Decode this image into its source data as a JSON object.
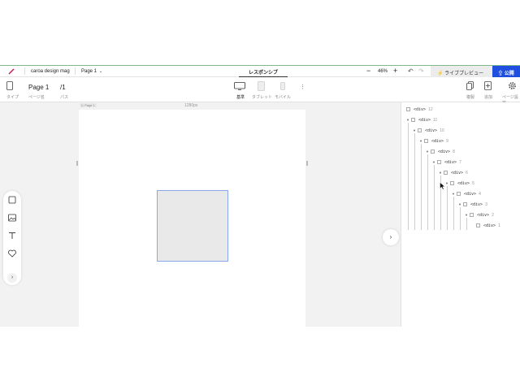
{
  "topbar": {
    "project_name": "caroa design mag",
    "page_selector": "Page 1",
    "mode_title": "レスポンシブ",
    "zoom_minus": "−",
    "zoom_level": "46%",
    "zoom_plus": "+",
    "live_preview": "ライブプレビュー",
    "publish": "公開"
  },
  "toolbar": {
    "type_label": "タイプ",
    "page_name": "Page 1",
    "page_name_label": "ページ名",
    "path": "/1",
    "path_label": "パス",
    "device_desktop": "基準",
    "device_tablet": "タブレット",
    "device_mobile": "モバイル",
    "duplicate_label": "複製",
    "add_label": "追加",
    "page_settings_label": "ページ設定"
  },
  "canvas": {
    "page_tag": "Page 1",
    "width_label": "1280px"
  },
  "layers": [
    {
      "tag": "<div>",
      "num": "12"
    },
    {
      "tag": "<div>",
      "num": "11"
    },
    {
      "tag": "<div>",
      "num": "10"
    },
    {
      "tag": "<div>",
      "num": "9"
    },
    {
      "tag": "<div>",
      "num": "8"
    },
    {
      "tag": "<div>",
      "num": "7"
    },
    {
      "tag": "<div>",
      "num": "6"
    },
    {
      "tag": "<div>",
      "num": "5"
    },
    {
      "tag": "<div>",
      "num": "4"
    },
    {
      "tag": "<div>",
      "num": "3"
    },
    {
      "tag": "<div>",
      "num": "2"
    },
    {
      "tag": "<div>",
      "num": "1"
    }
  ],
  "colors": {
    "accent": "#1f4fe0",
    "selection": "#8aa6ea"
  }
}
